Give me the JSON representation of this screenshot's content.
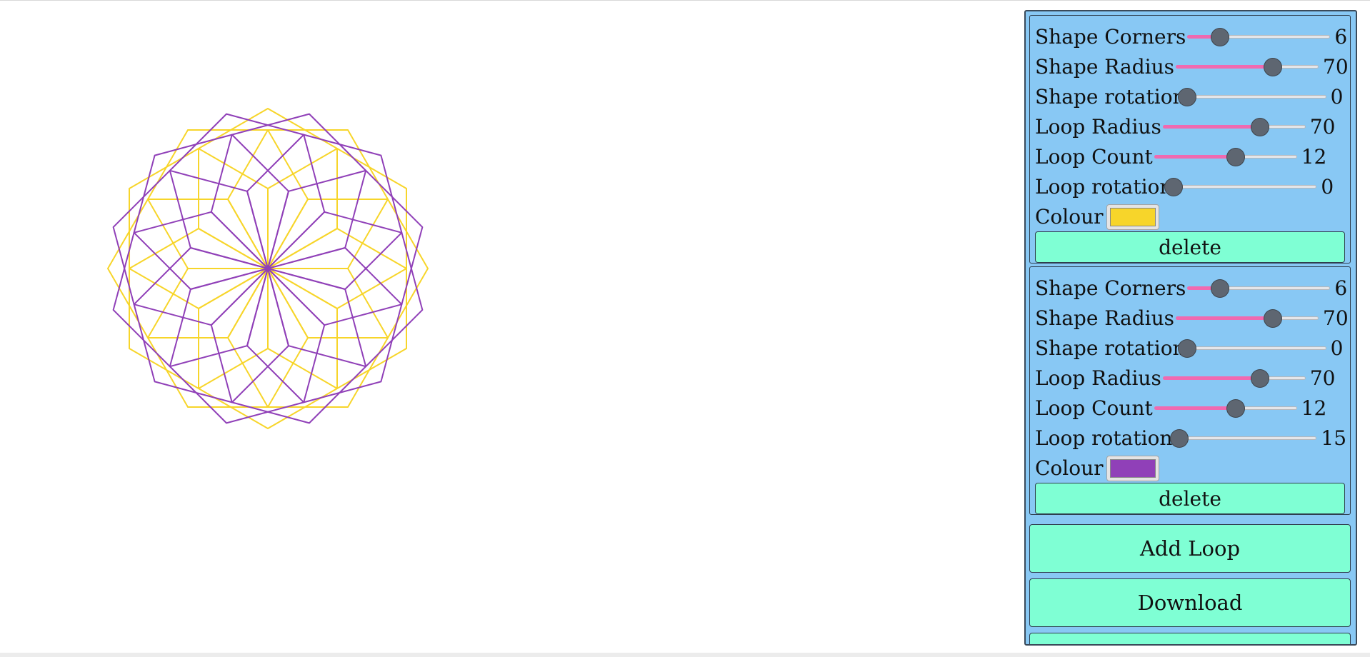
{
  "loops": [
    {
      "shape_corners": {
        "label": "Shape Corners",
        "value": "6",
        "fraction": 0.23
      },
      "shape_radius": {
        "label": "Shape Radius",
        "value": "70",
        "fraction": 0.68
      },
      "shape_rotation": {
        "label": "Shape rotation",
        "value": "0",
        "fraction": 0.0
      },
      "loop_radius": {
        "label": "Loop Radius",
        "value": "70",
        "fraction": 0.68
      },
      "loop_count": {
        "label": "Loop Count",
        "value": "12",
        "fraction": 0.57
      },
      "loop_rotation": {
        "label": "Loop rotation",
        "value": "0",
        "fraction": 0.0
      },
      "colour_label": "Colour",
      "colour": "#f7d52a",
      "delete_label": "delete"
    },
    {
      "shape_corners": {
        "label": "Shape Corners",
        "value": "6",
        "fraction": 0.23
      },
      "shape_radius": {
        "label": "Shape Radius",
        "value": "70",
        "fraction": 0.68
      },
      "shape_rotation": {
        "label": "Shape rotation",
        "value": "0",
        "fraction": 0.0
      },
      "loop_radius": {
        "label": "Loop Radius",
        "value": "70",
        "fraction": 0.68
      },
      "loop_count": {
        "label": "Loop Count",
        "value": "12",
        "fraction": 0.57
      },
      "loop_rotation": {
        "label": "Loop rotation",
        "value": "15",
        "fraction": 0.04
      },
      "colour_label": "Colour",
      "colour": "#9040b8",
      "delete_label": "delete"
    }
  ],
  "add_loop_label": "Add Loop",
  "download_label": "Download",
  "accent_colors": {
    "panel": "#88c8f4",
    "button": "#7fffd4",
    "slider_fill": "#f06ab0"
  }
}
